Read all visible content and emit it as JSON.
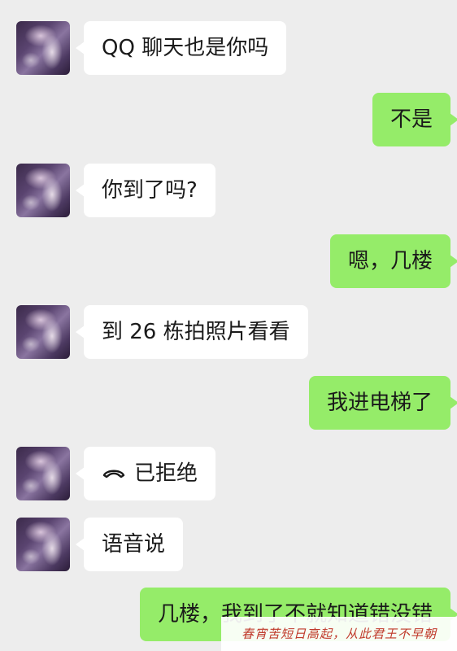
{
  "messages": [
    {
      "side": "in",
      "text": "QQ 聊天也是你吗"
    },
    {
      "side": "out",
      "text": "不是"
    },
    {
      "side": "in",
      "text": "你到了吗?"
    },
    {
      "side": "out",
      "text": "嗯，几楼"
    },
    {
      "side": "in",
      "text": "到 26 栋拍照片看看"
    },
    {
      "side": "out",
      "text": "我进电梯了"
    },
    {
      "side": "in",
      "type": "call",
      "icon": "phone-hangup-icon",
      "text": "已拒绝"
    },
    {
      "side": "in",
      "text": "语音说"
    },
    {
      "side": "out",
      "text": "几楼，我到了不就知道错没错"
    }
  ],
  "watermark": "春宵苦短日高起，从此君王不早朝",
  "colors": {
    "background": "#ededed",
    "incoming_bubble": "#ffffff",
    "outgoing_bubble": "#95ec69",
    "text": "#1a1a1a",
    "watermark_text": "#c0392b"
  }
}
